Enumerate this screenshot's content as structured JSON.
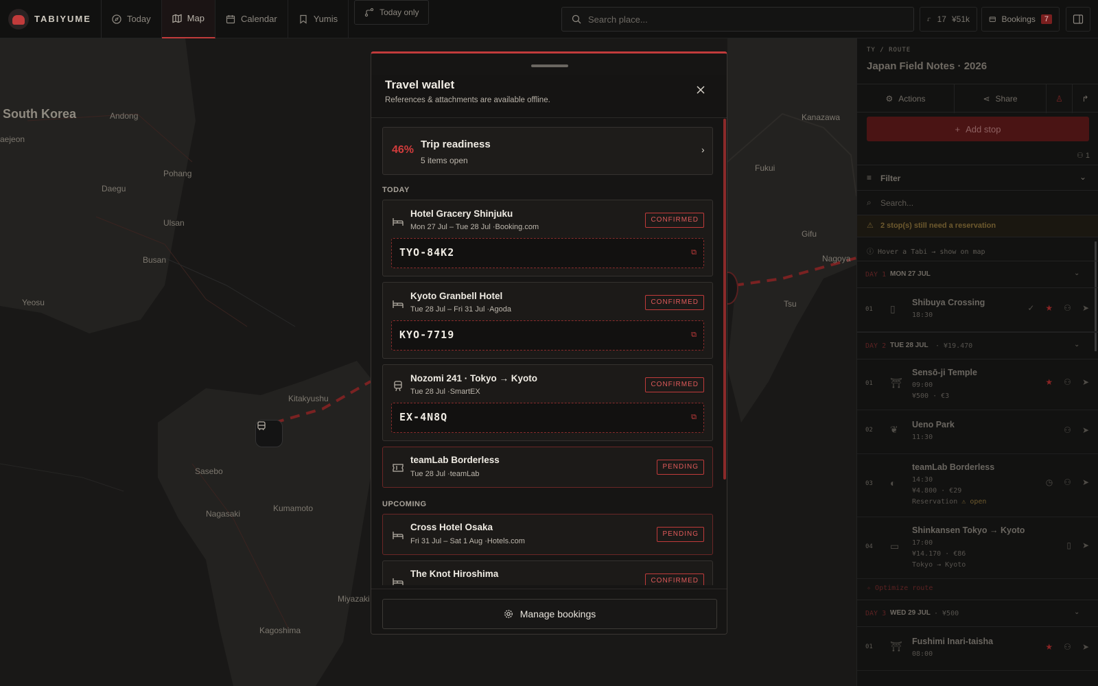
{
  "app": {
    "name": "TABIYUME"
  },
  "nav": {
    "today": "Today",
    "map": "Map",
    "calendar": "Calendar",
    "yumis": "Yumis",
    "today_only": "Today only"
  },
  "search": {
    "placeholder": "Search place..."
  },
  "stats": {
    "stops": "17",
    "budget": "¥51k"
  },
  "bookings": {
    "label": "Bookings",
    "count": "7"
  },
  "map": {
    "cities": [
      "South Korea",
      "Andong",
      "Daegu",
      "Pohang",
      "Ulsan",
      "Busan",
      "Yeosu",
      "Kitakyushu",
      "Sasebo",
      "Nagasaki",
      "Kumamoto",
      "Kagoshima",
      "Miyazaki",
      "Kanazawa",
      "Fukui",
      "Gifu",
      "Nagoya",
      "Tsu",
      "aejeon"
    ]
  },
  "modal": {
    "title": "Travel wallet",
    "subtitle": "References & attachments are available offline.",
    "readiness": {
      "percent": "46%",
      "title": "Trip readiness",
      "subtitle": "5 items open"
    },
    "section_today": "TODAY",
    "section_upcoming": "UPCOMING",
    "bookings": [
      {
        "name": "Hotel Gracery Shinjuku",
        "dates": "Mon 27 Jul – Tue 28 Jul",
        "provider": "·Booking.com",
        "status": "CONFIRMED",
        "ref": "TYO-84K2",
        "icon": "bed-icon"
      },
      {
        "name": "Kyoto Granbell Hotel",
        "dates": "Tue 28 Jul – Fri 31 Jul",
        "provider": "·Agoda",
        "status": "CONFIRMED",
        "ref": "KYO-7719",
        "icon": "bed-icon"
      },
      {
        "name": "Nozomi 241 · Tokyo → Kyoto",
        "dates": "Tue 28 Jul",
        "provider": "·SmartEX",
        "status": "CONFIRMED",
        "ref": "EX-4N8Q",
        "icon": "train-icon"
      },
      {
        "name": "teamLab Borderless",
        "dates": "Tue 28 Jul",
        "provider": "·teamLab",
        "status": "PENDING",
        "icon": "ticket-icon"
      },
      {
        "name": "Cross Hotel Osaka",
        "dates": "Fri 31 Jul – Sat 1 Aug",
        "provider": "·Hotels.com",
        "status": "PENDING",
        "icon": "bed-icon"
      },
      {
        "name": "The Knot Hiroshima",
        "status": "CONFIRMED",
        "icon": "bed-icon"
      }
    ],
    "manage_label": "Manage bookings"
  },
  "sidebar": {
    "breadcrumb": "TY / ROUTE",
    "title": "Japan Field Notes · 2026",
    "actions_label": "Actions",
    "share_label": "Share",
    "add_stop_label": "Add stop",
    "participants": "1",
    "filter_label": "Filter",
    "search_placeholder": "Search...",
    "warning": "2 stop(s) still need a reservation",
    "hover_note": "Hover a Tabi → show on map",
    "days": [
      {
        "label": "DAY 1",
        "date": "MON 27 JUL",
        "amount": ""
      },
      {
        "label": "DAY 2",
        "date": "TUE 28 JUL",
        "amount": "· ¥19.470"
      },
      {
        "label": "DAY 3",
        "date": "WED 29 JUL",
        "amount": "· ¥500"
      }
    ],
    "stops": [
      {
        "num": "01",
        "name": "Shibuya Crossing",
        "time": "18:30"
      },
      {
        "num": "01",
        "name": "Sensō-ji Temple",
        "time": "09:00",
        "cost": "¥500 · €3"
      },
      {
        "num": "02",
        "name": "Ueno Park",
        "time": "11:30"
      },
      {
        "num": "03",
        "name": "teamLab Borderless",
        "time": "14:30",
        "cost": "¥4.800 · €29",
        "note": "Reservation",
        "note_status": "open"
      },
      {
        "num": "04",
        "name": "Shinkansen Tokyo → Kyoto",
        "time": "17:00",
        "cost": "¥14.170 · €86",
        "route": "Tokyo → Kyoto"
      },
      {
        "num": "01",
        "name": "Fushimi Inari-taisha",
        "time": "08:00"
      }
    ],
    "optimize_label": "Optimize route"
  },
  "colors": {
    "accent": "#c23b3b",
    "bg": "#161514"
  }
}
